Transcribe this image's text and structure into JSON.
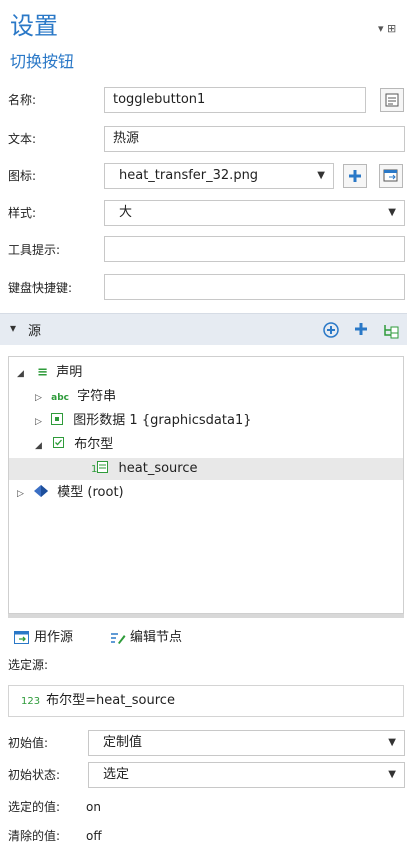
{
  "header": {
    "title": "设置",
    "subtitle": "切换按钮",
    "pin_glyph": "▾ ⊞"
  },
  "form": {
    "name": {
      "label": "名称:",
      "value": "togglebutton1"
    },
    "text": {
      "label": "文本:",
      "value": "热源"
    },
    "icon": {
      "label": "图标:",
      "value": "heat_transfer_32.png"
    },
    "style": {
      "label": "样式:",
      "value": "大"
    },
    "tooltip": {
      "label": "工具提示:",
      "value": ""
    },
    "shortcut": {
      "label": "键盘快捷键:",
      "value": ""
    }
  },
  "source_section": {
    "label": "源",
    "collapse_glyph": "▾"
  },
  "tree": {
    "declarations": "声明",
    "strings": "字符串",
    "strings_badge": "abc",
    "graphics": "图形数据 1 {graphicsdata1}",
    "boolean": "布尔型",
    "heat_source": "heat_source",
    "heat_source_badge": "1",
    "model": "模型 (root)"
  },
  "actions": {
    "use_as_source": "用作源",
    "edit_node": "编辑节点"
  },
  "selected_source": {
    "label": "选定源:",
    "badge": "123",
    "value": "布尔型=heat_source"
  },
  "initial_value": {
    "label": "初始值:",
    "value": "定制值"
  },
  "initial_state": {
    "label": "初始状态:",
    "value": "选定"
  },
  "selected_value": {
    "label": "选定的值:",
    "value": "on"
  },
  "cleared_value": {
    "label": "清除的值:",
    "value": "off"
  },
  "colors": {
    "accent": "#2a78c7",
    "section_bg": "#e6ebf2",
    "tree_green": "#2e9b3a"
  }
}
